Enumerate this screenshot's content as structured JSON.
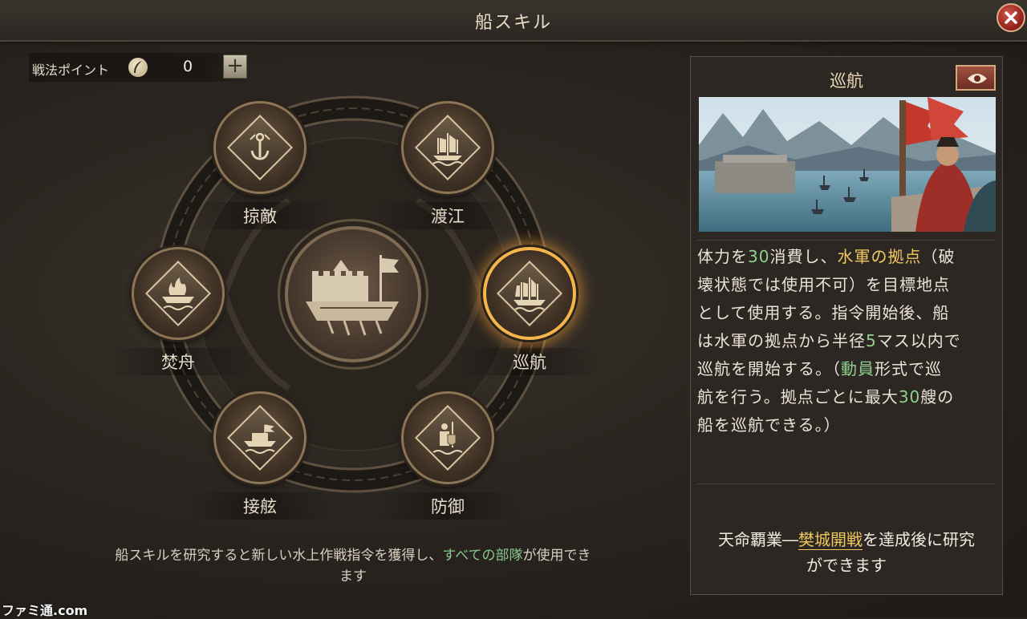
{
  "window": {
    "title": "船スキル"
  },
  "points": {
    "label": "戦法ポイント",
    "value": "0",
    "add_label": "+"
  },
  "skills": [
    {
      "name": "掠敵",
      "icon": "anchor-chain-icon",
      "selected": false
    },
    {
      "name": "渡江",
      "icon": "junk-ship-icon",
      "selected": false
    },
    {
      "name": "焚舟",
      "icon": "burning-ship-icon",
      "selected": false
    },
    {
      "name": "巡航",
      "icon": "sailing-ship-icon",
      "selected": true
    },
    {
      "name": "接舷",
      "icon": "boarding-ship-icon",
      "selected": false
    },
    {
      "name": "防御",
      "icon": "soldier-shield-icon",
      "selected": false
    }
  ],
  "center": {
    "icon": "warship-icon"
  },
  "bottom_note": {
    "part1": "船スキルを研究すると新しい水上作戦指令を獲得し、",
    "highlight": "すべての部隊",
    "part2": "が使用でき",
    "line2": "ます"
  },
  "panel": {
    "title": "巡航",
    "eye_icon": "eye-icon",
    "description": {
      "t1": "体力を",
      "n1": "30",
      "t2": "消費し、",
      "k1": "水軍の拠点",
      "t3": "（破",
      "t4": "壊状態では使用不可）を目標地点",
      "t5": "として使用する。指令開始後、船",
      "t6": "は水軍の拠点から半径",
      "n2": "5",
      "t7": "マス以内で",
      "t8": "巡航を開始する。（",
      "k2": "動員",
      "t9": "形式で巡",
      "t10": "航を行う。拠点ごとに最大",
      "n3": "30",
      "t11": "艘の",
      "t12": "船を巡航できる。）"
    },
    "requirement": {
      "prefix": "天命覇業―",
      "link": "樊城開戦",
      "suffix": "を達成後に研究",
      "line2": "ができます"
    }
  },
  "watermark": "ファミ通.com",
  "colors": {
    "accent_gold": "#f0c860",
    "highlight_green": "#88c98e",
    "selected_glow": "#f4b54a"
  }
}
